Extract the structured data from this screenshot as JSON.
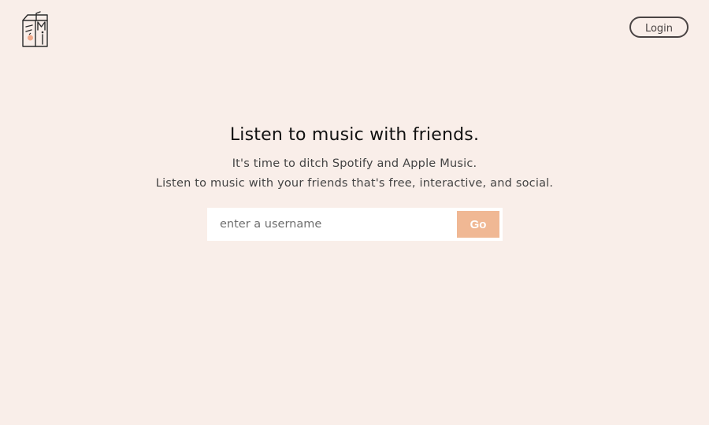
{
  "header": {
    "logo_icon": "juice-box-music-logo-icon",
    "login_label": "Login"
  },
  "hero": {
    "title": "Listen to music with friends.",
    "subtitle_line1": "It's time to ditch Spotify and Apple Music.",
    "subtitle_line2": "Listen to music with your friends that's free, interactive, and social."
  },
  "search": {
    "placeholder": "enter a username",
    "value": "",
    "go_label": "Go"
  },
  "colors": {
    "background": "#f9eee9",
    "accent": "#f0b894",
    "outline": "#4a4444"
  }
}
